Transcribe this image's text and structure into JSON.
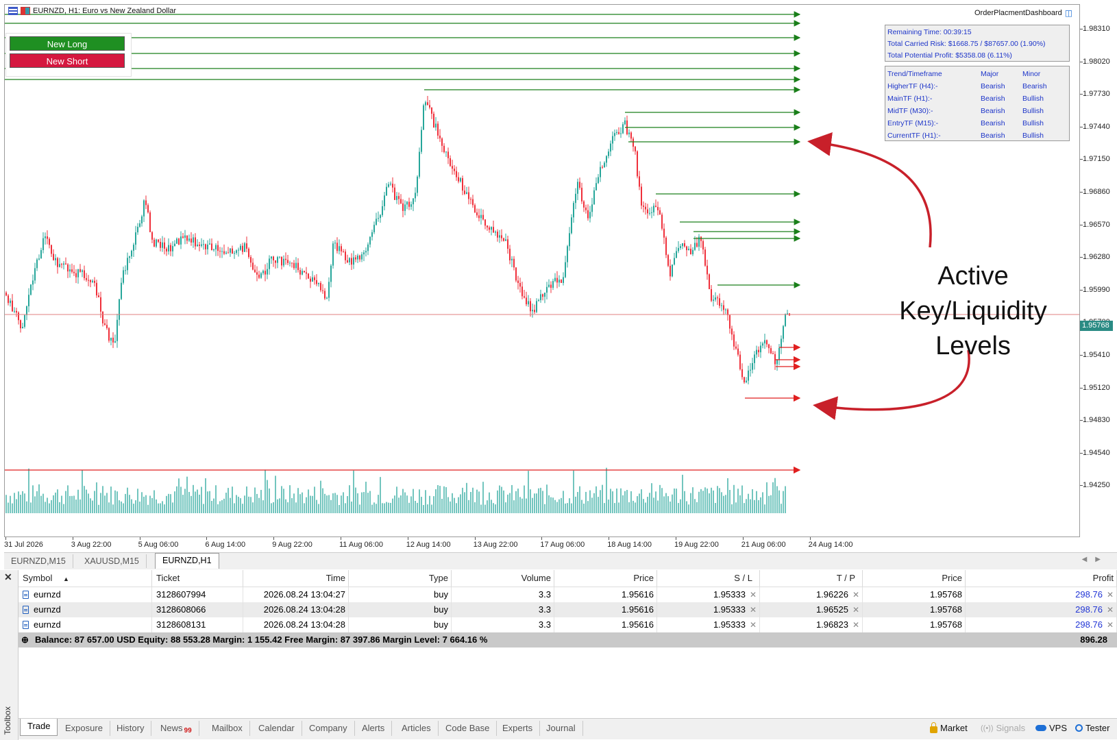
{
  "chart": {
    "title": "EURNZD, H1:  Euro vs New Zealand Dollar",
    "dashboard_title": "OrderPlacmentDashboard",
    "buttons": {
      "long": "New Long",
      "short": "New Short"
    },
    "price_axis": [
      "1.98310",
      "1.98020",
      "1.97730",
      "1.97440",
      "1.97150",
      "1.96860",
      "1.96570",
      "1.96280",
      "1.95990",
      "1.95700",
      "1.95410",
      "1.95120",
      "1.94830",
      "1.94540",
      "1.94250"
    ],
    "current_price": "1.95768",
    "time_axis": [
      "31 Jul 2026",
      "3 Aug 22:00",
      "5 Aug 06:00",
      "6 Aug 14:00",
      "9 Aug 22:00",
      "11 Aug 06:00",
      "12 Aug 14:00",
      "13 Aug 22:00",
      "17 Aug 06:00",
      "18 Aug 14:00",
      "19 Aug 22:00",
      "21 Aug 06:00",
      "24 Aug 14:00"
    ],
    "risk_panel": {
      "remaining_time": "Remaining Time: 00:39:15",
      "carried_risk": "Total Carried Risk: $1668.75 / $87657.00 (1.90%)",
      "potential_profit": "Total Potential Profit: $5358.08 (6.11%)"
    },
    "trend_panel": {
      "headers": [
        "Trend/Timeframe",
        "Major",
        "Minor"
      ],
      "rows": [
        [
          "HigherTF (H4):-",
          "Bearish",
          "Bearish"
        ],
        [
          "MainTF (H1):-",
          "Bearish",
          "Bullish"
        ],
        [
          "MidTF (M30):-",
          "Bearish",
          "Bullish"
        ],
        [
          "EntryTF (M15):-",
          "Bearish",
          "Bullish"
        ],
        [
          "CurrentTF (H1):-",
          "Bearish",
          "Bullish"
        ]
      ]
    },
    "annotation": [
      "Active",
      "Key/Liquidity",
      "Levels"
    ],
    "colors": {
      "bull": "#26a69a",
      "bear": "#ef2f3a",
      "level_up": "#1a7f1a",
      "level_down": "#e01f1f",
      "annotation_arrow": "#c8202a"
    }
  },
  "chart_tabs": [
    "EURNZD,M15",
    "XAUUSD,M15",
    "EURNZD,H1"
  ],
  "chart_tabs_active": "EURNZD,H1",
  "trade_table": {
    "headers": [
      "Symbol",
      "Ticket",
      "Time",
      "Type",
      "Volume",
      "Price",
      "S / L",
      "T / P",
      "Price",
      "Profit"
    ],
    "rows": [
      [
        "eurnzd",
        "3128607994",
        "2026.08.24 13:04:27",
        "buy",
        "3.3",
        "1.95616",
        "1.95333",
        "1.96226",
        "1.95768",
        "298.76"
      ],
      [
        "eurnzd",
        "3128608066",
        "2026.08.24 13:04:28",
        "buy",
        "3.3",
        "1.95616",
        "1.95333",
        "1.96525",
        "1.95768",
        "298.76"
      ],
      [
        "eurnzd",
        "3128608131",
        "2026.08.24 13:04:28",
        "buy",
        "3.3",
        "1.95616",
        "1.95333",
        "1.96823",
        "1.95768",
        "298.76"
      ]
    ],
    "summary": "Balance: 87 657.00 USD  Equity: 88 553.28  Margin: 1 155.42  Free Margin: 87 397.86  Margin Level: 7 664.16 %",
    "summary_profit": "896.28"
  },
  "toolbox": {
    "label": "Toolbox",
    "tabs": [
      "Trade",
      "Exposure",
      "History",
      "News",
      "Mailbox",
      "Calendar",
      "Company",
      "Alerts",
      "Articles",
      "Code Base",
      "Experts",
      "Journal"
    ],
    "news_badge": "99",
    "status": [
      "Market",
      "Signals",
      "VPS",
      "Tester"
    ]
  }
}
